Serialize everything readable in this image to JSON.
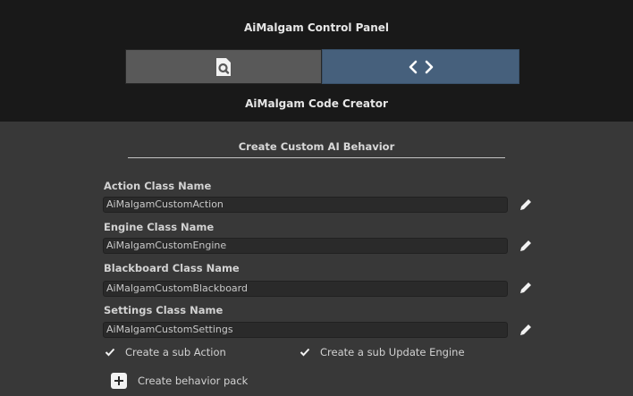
{
  "window": {
    "title": "AiMalgam Control Panel",
    "subtitle": "AiMalgam Code Creator"
  },
  "tabs": [
    {
      "icon": "search-document-icon",
      "active": false
    },
    {
      "icon": "code-brackets-icon",
      "active": true
    }
  ],
  "section": {
    "title": "Create Custom AI Behavior"
  },
  "fields": [
    {
      "label": "Action Class Name",
      "value": "AiMalgamCustomAction"
    },
    {
      "label": "Engine Class Name",
      "value": "AiMalgamCustomEngine"
    },
    {
      "label": "Blackboard Class Name",
      "value": "AiMalgamCustomBlackboard"
    },
    {
      "label": "Settings Class Name",
      "value": "AiMalgamCustomSettings"
    }
  ],
  "checkboxes": [
    {
      "label": "Create a sub Action",
      "checked": true
    },
    {
      "label": "Create a sub Update Engine",
      "checked": true
    }
  ],
  "pack": {
    "label": "Create behavior pack",
    "icon": "plus-icon"
  },
  "colors": {
    "header_bg": "#191919",
    "body_bg": "#383838",
    "active_tab": "#46607c",
    "inactive_tab": "#595959"
  }
}
